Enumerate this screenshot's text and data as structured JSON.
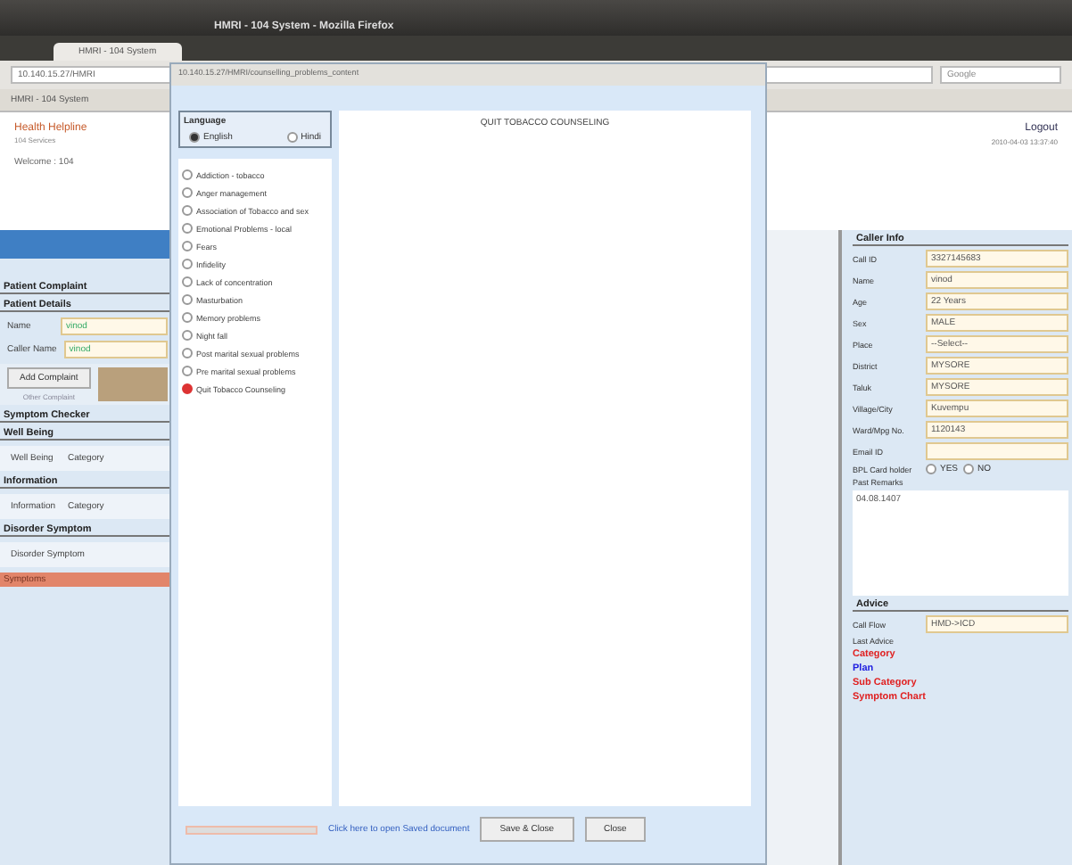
{
  "window": {
    "title": "HMRI - 104 System - Mozilla Firefox"
  },
  "browser": {
    "tabs": [
      {
        "label": "HMRI - 104 System",
        "selected": true
      }
    ],
    "url": "10.140.15.27/HMRI",
    "search": "Google",
    "page_tab": "HMRI - 104 System"
  },
  "header": {
    "logo": "Health Helpline",
    "sub": "104 Services",
    "user": "Welcome : 104",
    "logout": "Logout",
    "datetime": "2010-04-03 13:37:40"
  },
  "left": {
    "title": "Patient Complaint",
    "details_title": "Patient Details",
    "fields": [
      {
        "label": "Name",
        "value": "vinod"
      },
      {
        "label": "Caller Name",
        "value": "vinod"
      }
    ],
    "add_button": "Add Complaint",
    "add_note": "Other Complaint",
    "checker_title": "Symptom Checker",
    "sections": [
      {
        "title": "Well Being",
        "items": [
          "Well Being",
          "Category"
        ]
      },
      {
        "title": "Information",
        "items": [
          "Information",
          "Category"
        ]
      },
      {
        "title": "Disorder Symptom",
        "items": [
          "Disorder Symptom"
        ]
      }
    ],
    "symptoms": "Symptoms"
  },
  "caller": {
    "title": "Caller Info",
    "fields": [
      {
        "label": "Call ID",
        "value": "3327145683"
      },
      {
        "label": "Name",
        "value": "vinod"
      },
      {
        "label": "Age",
        "value": "22  Years"
      },
      {
        "label": "Sex",
        "value": "MALE"
      },
      {
        "label": "Place",
        "value": "--Select--"
      },
      {
        "label": "District",
        "value": "MYSORE"
      },
      {
        "label": "Taluk",
        "value": "MYSORE"
      },
      {
        "label": "Village/City",
        "value": "Kuvempu"
      },
      {
        "label": "Ward/Mpg No.",
        "value": "1120143"
      },
      {
        "label": "Email ID"
      }
    ],
    "card_label": "BPL Card holder",
    "card_options": [
      {
        "label": "YES",
        "selected": false
      },
      {
        "label": "NO",
        "selected": false
      }
    ],
    "remarks_label": "Past Remarks",
    "remarks": "04.08.1407"
  },
  "advice": {
    "title": "Advice",
    "call_flow_label": "Call Flow",
    "call_flow": "HMD->ICD",
    "last_advice": "Last Advice",
    "lines": [
      {
        "text": "Category",
        "color": "#e02020"
      },
      {
        "text": "Plan",
        "color": "#2020e0"
      },
      {
        "text": "Sub Category",
        "color": "#e02020"
      },
      {
        "text": "Symptom Chart",
        "color": "#e02020"
      }
    ]
  },
  "popup": {
    "url": "10.140.15.27/HMRI/counselling_problems_content",
    "language_title": "Language",
    "languages": [
      {
        "label": "English",
        "selected": true
      },
      {
        "label": "Hindi",
        "selected": false
      }
    ],
    "topics": [
      {
        "label": "Addiction - tobacco",
        "selected": false
      },
      {
        "label": "Anger management",
        "selected": false
      },
      {
        "label": "Association of Tobacco and sex",
        "selected": false
      },
      {
        "label": "Emotional Problems - local",
        "selected": false
      },
      {
        "label": "Fears",
        "selected": false
      },
      {
        "label": "Infidelity",
        "selected": false
      },
      {
        "label": "Lack of concentration",
        "selected": false
      },
      {
        "label": "Masturbation",
        "selected": false
      },
      {
        "label": "Memory problems",
        "selected": false
      },
      {
        "label": "Night fall",
        "selected": false
      },
      {
        "label": "Post marital sexual problems",
        "selected": false
      },
      {
        "label": "Pre marital sexual problems",
        "selected": false
      },
      {
        "label": "Quit Tobacco Counseling",
        "selected": true
      }
    ],
    "content_title": "QUIT TOBACCO COUNSELING",
    "link": "Click here to open Saved document",
    "buttons": [
      "Save & Close",
      "Close"
    ]
  }
}
